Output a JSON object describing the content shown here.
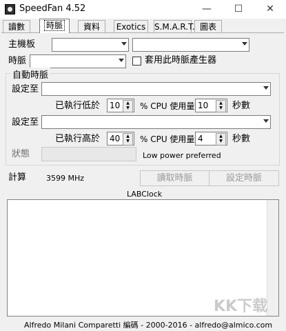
{
  "window": {
    "title": "SpeedFan 4.52",
    "controls": [
      "—",
      "☐",
      "✕"
    ]
  },
  "tabs": [
    "讀數",
    "時脈",
    "資料",
    "Exotics",
    "S.M.A.R.T.",
    "圖表"
  ],
  "active_tab": "時脈",
  "clock": {
    "motherboard_label": "主機板",
    "motherboard_value": "",
    "motherboard_value2": "",
    "clock_label": "時脈",
    "clock_value": "",
    "use_generator_label": "套用此時脈產生器",
    "use_generator_checked": false
  },
  "auto": {
    "group_title": "自動時脈",
    "set_to_label": "設定至",
    "low": {
      "prefix": "已執行低於",
      "cpu_value": "10",
      "mid": "% CPU 使用量",
      "seconds_value": "10",
      "suffix": "秒數"
    },
    "set_to_label2": "設定至",
    "high": {
      "prefix": "已執行高於",
      "cpu_value": "40",
      "mid": "% CPU 使用量",
      "seconds_value": "4",
      "suffix": "秒數"
    },
    "status_label": "狀態",
    "status_text": "Low power preferred"
  },
  "calc": {
    "label": "計算",
    "value": "3599 MHz",
    "read_button": "讀取時脈",
    "set_button": "設定時脈",
    "labclock": "LABClock"
  },
  "statusbar": "Alfredo Milani Comparetti 編碼 - 2000-2016 - alfredo@almico.com",
  "watermark": "KK下载"
}
